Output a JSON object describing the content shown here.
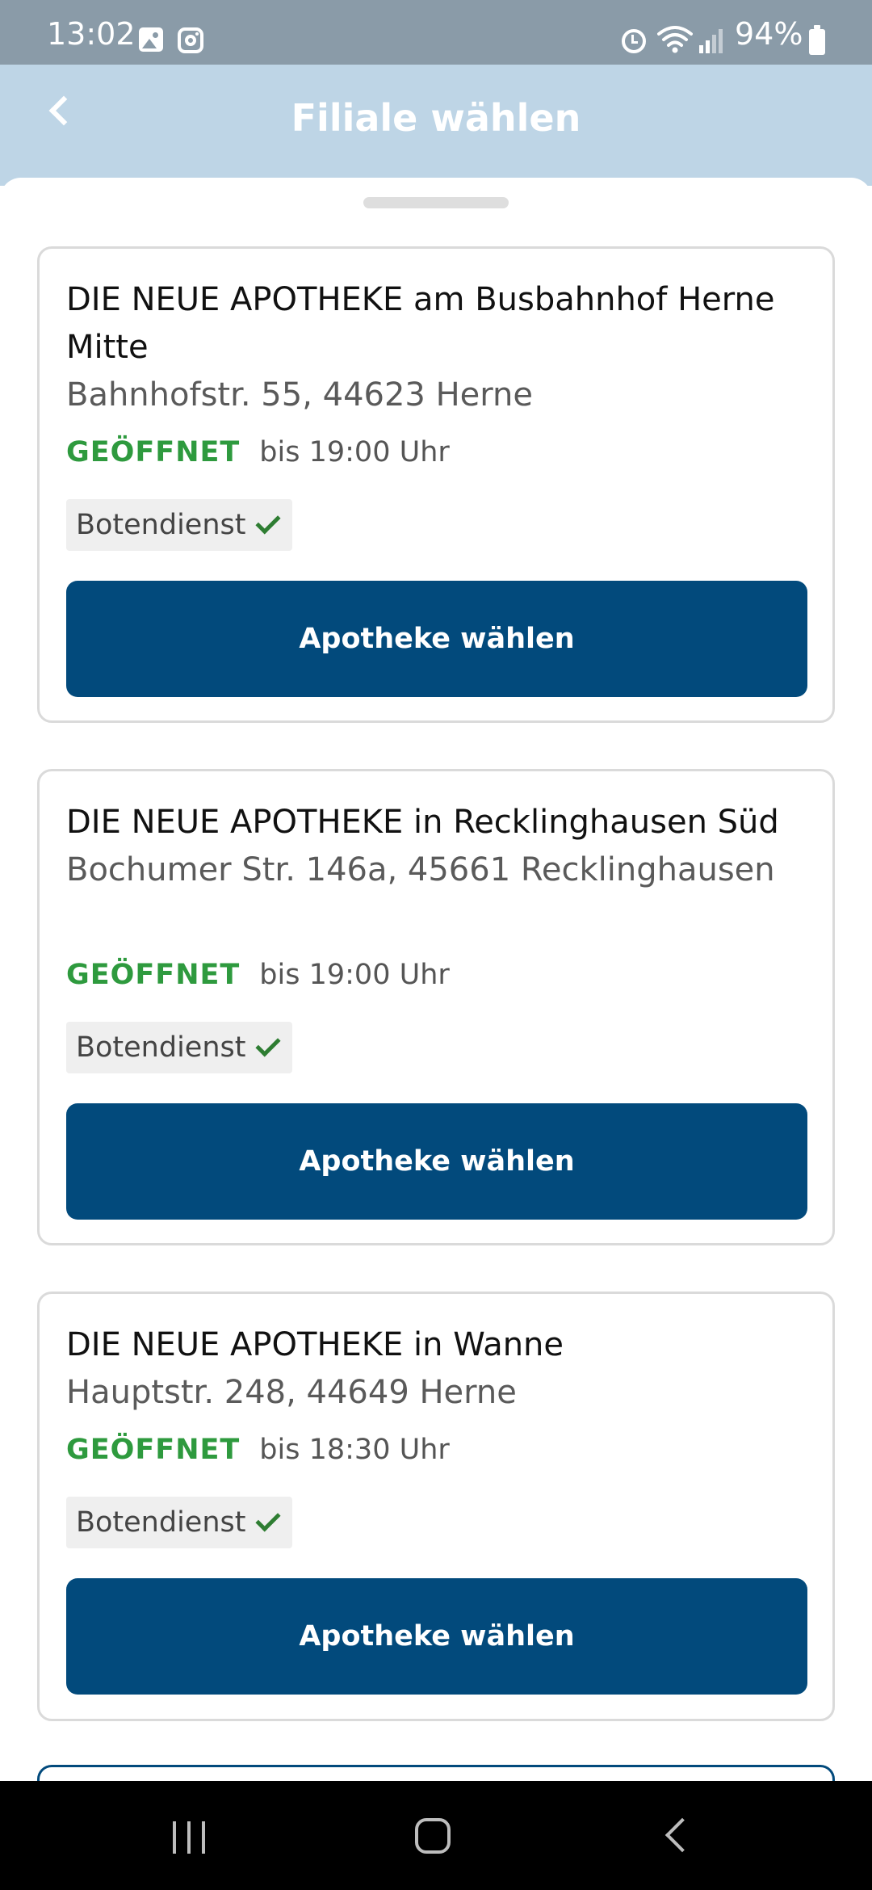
{
  "status_bar": {
    "time": "13:02",
    "battery": "94%"
  },
  "header": {
    "title": "Filiale wählen"
  },
  "pharmacies": [
    {
      "name": "DIE NEUE APOTHEKE am Busbahnhof Herne Mitte",
      "address": "Bahnhofstr. 55, 44623 Herne",
      "status": "GEÖFFNET",
      "hours": "bis 19:00 Uhr",
      "service": "Botendienst",
      "button": "Apotheke wählen"
    },
    {
      "name": "DIE NEUE APOTHEKE in Recklinghausen Süd",
      "address": "Bochumer Str. 146a, 45661 Recklinghausen",
      "status": "GEÖFFNET",
      "hours": "bis 19:00 Uhr",
      "service": "Botendienst",
      "button": "Apotheke wählen"
    },
    {
      "name": "DIE NEUE APOTHEKE in Wanne",
      "address": "Hauptstr. 248, 44649 Herne",
      "status": "GEÖFFNET",
      "hours": "bis 18:30 Uhr",
      "service": "Botendienst",
      "button": "Apotheke wählen"
    }
  ],
  "icons": {
    "status_bar": [
      "gallery-icon",
      "instagram-icon",
      "alarm-icon",
      "wifi-icon",
      "signal-icon",
      "battery-icon"
    ],
    "header": "back-chevron-icon",
    "chip": "checkmark-icon",
    "nav": [
      "recents-icon",
      "home-icon",
      "back-icon"
    ]
  },
  "colors": {
    "header_bg": "#bed5e6",
    "primary_button": "#024a7c",
    "open_status": "#2e9a3e",
    "check": "#2e7d32"
  }
}
